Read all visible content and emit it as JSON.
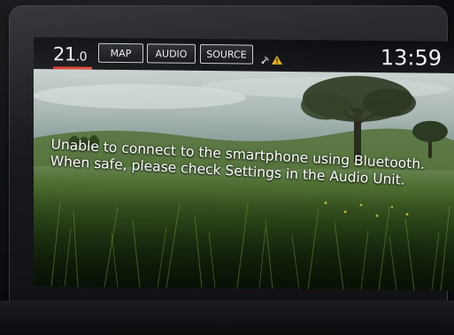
{
  "status_bar": {
    "temperature_main": "21",
    "temperature_decimal": ".0",
    "map_label": "MAP",
    "audio_label": "AUDIO",
    "source_label": "SOURCE",
    "time": "13:59"
  },
  "message": {
    "text": "Unable to connect to the smartphone using Bluetooth. When safe, please check Settings in the Audio Unit."
  },
  "icons": {
    "status_icon_1": "satellite-signal-icon",
    "status_icon_2": "warning-icon"
  },
  "colors": {
    "temperature_accent": "#d6342c",
    "warning_icon": "#e8b020",
    "text": "#ffffff"
  }
}
